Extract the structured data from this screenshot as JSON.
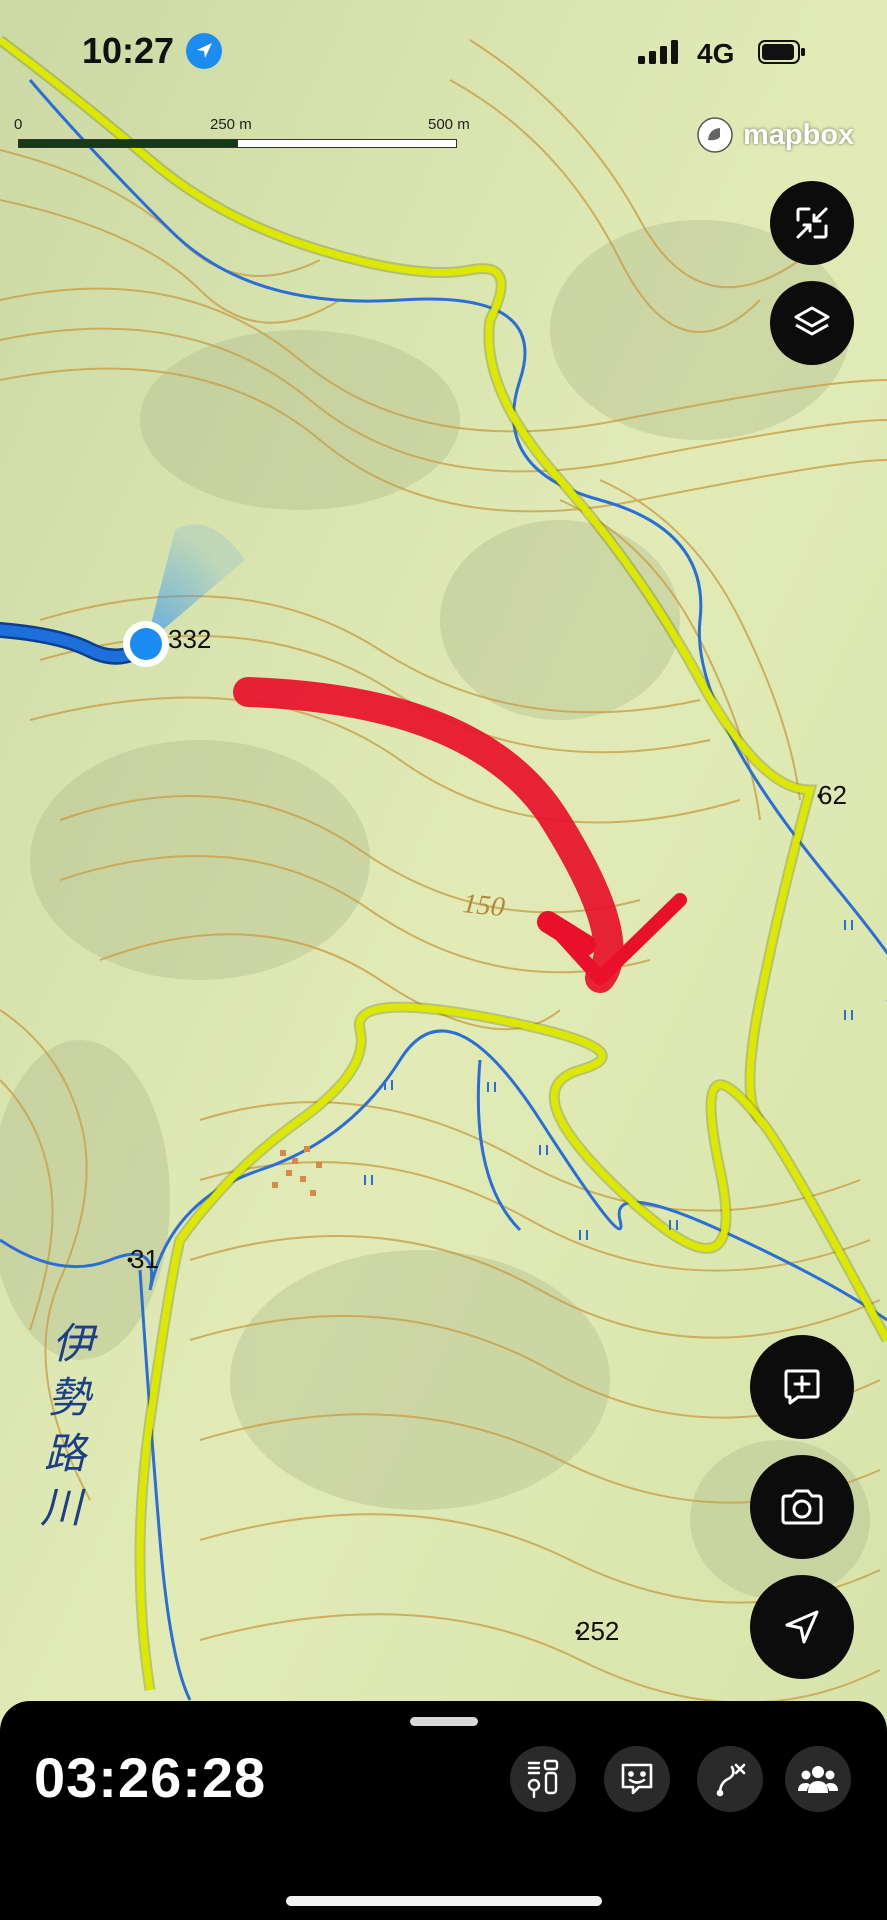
{
  "status_bar": {
    "time": "10:27",
    "network": "4G"
  },
  "map": {
    "scale_bar": {
      "labels": [
        "0",
        "250 m",
        "500 m"
      ]
    },
    "attribution": "mapbox",
    "elevation_labels": [
      "332",
      "62",
      "31",
      "252"
    ],
    "contour_label": "150",
    "river_name": [
      "伊",
      "勢",
      "路",
      "川"
    ],
    "colors": {
      "land": "#e6efb8",
      "contour": "#c7a04a",
      "road": "#dde800",
      "river": "#2b6fd6",
      "current_track": "#1d6fdc",
      "location_dot": "#1a8cf1",
      "arrow_annotation": "#e8102a"
    }
  },
  "controls": {
    "top": [
      {
        "name": "fullscreen-button",
        "icon": "expand-icon"
      },
      {
        "name": "layers-button",
        "icon": "layers-icon"
      }
    ],
    "bottom": [
      {
        "name": "add-note-button",
        "icon": "add-note-icon"
      },
      {
        "name": "camera-button",
        "icon": "camera-icon"
      },
      {
        "name": "recenter-location-button",
        "icon": "location-arrow-icon"
      }
    ]
  },
  "panel": {
    "elapsed_time": "03:26:28",
    "tools": [
      "trail-info-icon",
      "face-chat-icon",
      "route-off-icon",
      "group-icon"
    ]
  }
}
